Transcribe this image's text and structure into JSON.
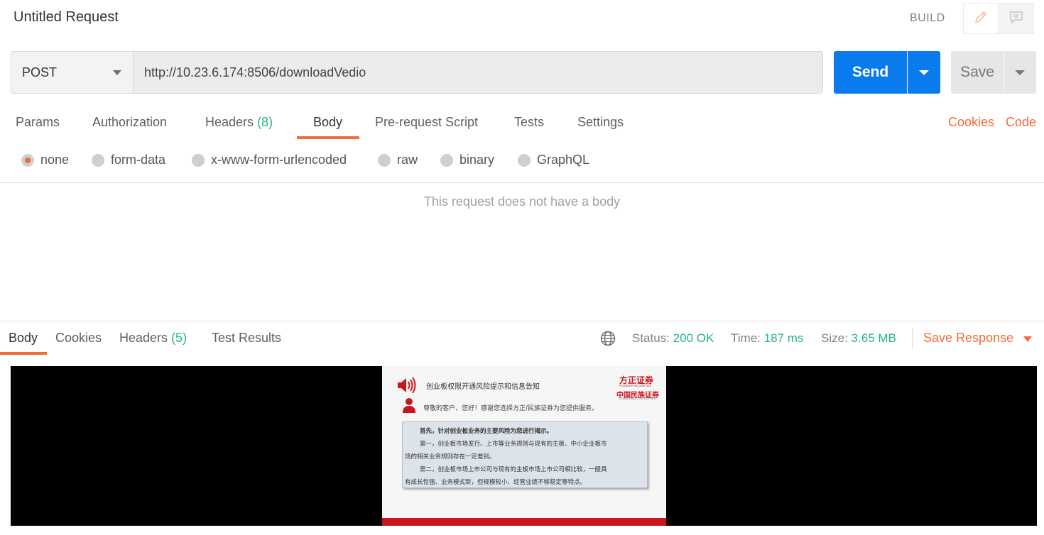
{
  "header": {
    "title": "Untitled Request",
    "build_label": "BUILD",
    "edit_icon": "pencil-icon",
    "comment_icon": "comment-icon"
  },
  "request": {
    "method": "POST",
    "url": "http://10.23.6.174:8506/downloadVedio",
    "send_label": "Send",
    "save_label": "Save"
  },
  "request_tabs": {
    "params": "Params",
    "authorization": "Authorization",
    "headers": "Headers",
    "headers_count": "(8)",
    "body": "Body",
    "prerequest": "Pre-request Script",
    "tests": "Tests",
    "settings": "Settings",
    "cookies": "Cookies",
    "code": "Code",
    "active": "Body"
  },
  "body_types": {
    "none": "none",
    "form_data": "form-data",
    "urlencoded": "x-www-form-urlencoded",
    "raw": "raw",
    "binary": "binary",
    "graphql": "GraphQL",
    "selected": "none"
  },
  "empty_body_message": "This request does not have a body",
  "response_tabs": {
    "body": "Body",
    "cookies": "Cookies",
    "headers": "Headers",
    "headers_count": "(5)",
    "test_results": "Test Results",
    "active": "Body"
  },
  "response_status": {
    "status_label": "Status:",
    "status_value": "200 OK",
    "time_label": "Time:",
    "time_value": "187 ms",
    "size_label": "Size:",
    "size_value": "3.65 MB",
    "save_response": "Save Response",
    "globe_icon": "globe-icon"
  },
  "video_preview": {
    "slide_title": "创业板权限开通风险提示和信息告知",
    "greeting": "尊敬的客户，您好！感谢您选择方正/民族证券为您提供服务。",
    "logo1": "方正证券",
    "logo1_sub": "FOUNDER SECURITIES",
    "logo2": "中国民族证券",
    "logo2_sub": "CHINA MINZU SECURITIES",
    "line1": "首先，针对创业板业务的主要风险为您进行揭示。",
    "line2": "第一，创业板市场发行、上市等业务规则与现有的主板、中小企业板市",
    "line3": "场的相关业务规则存在一定差别。",
    "line4": "第二，创业板市场上市公司与现有的主板市场上市公司相比较，一般具",
    "line5": "有成长性强、业务模式新，但规模较小、经营业绩不够稳定等特点。",
    "accent_color": "#c8161d"
  },
  "colors": {
    "accent": "#f26b3a",
    "primary": "#097bed",
    "success": "#26b47f"
  }
}
